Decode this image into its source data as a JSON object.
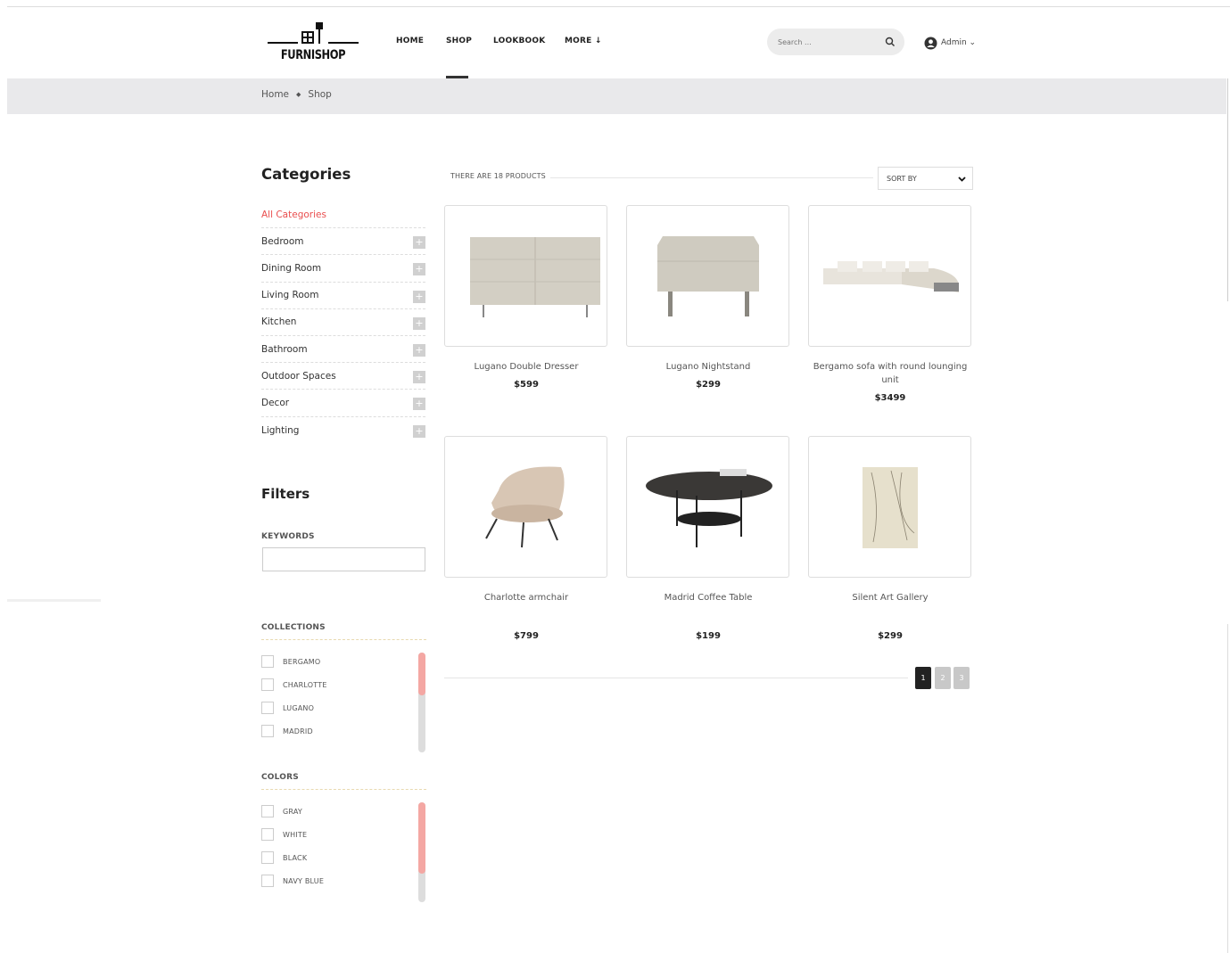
{
  "brand": {
    "name": "FURNISHOP"
  },
  "nav": {
    "items": [
      "HOME",
      "SHOP",
      "LOOKBOOK",
      "MORE ↓"
    ],
    "active": "SHOP"
  },
  "search": {
    "placeholder": "Search ..."
  },
  "user": {
    "label": "Admin ⌄"
  },
  "breadcrumb": {
    "home": "Home",
    "separator": "◆",
    "current": "Shop"
  },
  "sidebar": {
    "categories_title": "Categories",
    "categories": [
      {
        "label": "All Categories",
        "active": true
      },
      {
        "label": "Bedroom"
      },
      {
        "label": "Dining Room"
      },
      {
        "label": "Living Room"
      },
      {
        "label": "Kitchen"
      },
      {
        "label": "Bathroom"
      },
      {
        "label": "Outdoor Spaces"
      },
      {
        "label": "Decor"
      },
      {
        "label": "Lighting"
      }
    ],
    "filters_title": "Filters",
    "keywords_label": "KEYWORDS",
    "collections_label": "COLLECTIONS",
    "collections": [
      "BERGAMO",
      "CHARLOTTE",
      "LUGANO",
      "MADRID"
    ],
    "colors_label": "COLORS",
    "colors": [
      "GRAY",
      "WHITE",
      "BLACK",
      "NAVY BLUE"
    ],
    "plus_symbol": "+"
  },
  "listing": {
    "count_text": "THERE ARE 18 PRODUCTS",
    "sort_label": "SORT BY",
    "products": [
      {
        "name": "Lugano Double Dresser",
        "price": "$599"
      },
      {
        "name": "Lugano Nightstand",
        "price": "$299"
      },
      {
        "name": "Bergamo sofa with round lounging unit",
        "price": "$3499"
      },
      {
        "name": "Charlotte armchair",
        "price": "$799"
      },
      {
        "name": "Madrid Coffee Table",
        "price": "$199"
      },
      {
        "name": "Silent Art Gallery",
        "price": "$299"
      }
    ],
    "pages": [
      "1",
      "2",
      "3"
    ],
    "current_page": "1"
  },
  "colors_theme": {
    "accent": "#e94e4e",
    "scroll_thumb": "#f4a7a3",
    "breadcrumb_bg": "#e9e9eb"
  }
}
